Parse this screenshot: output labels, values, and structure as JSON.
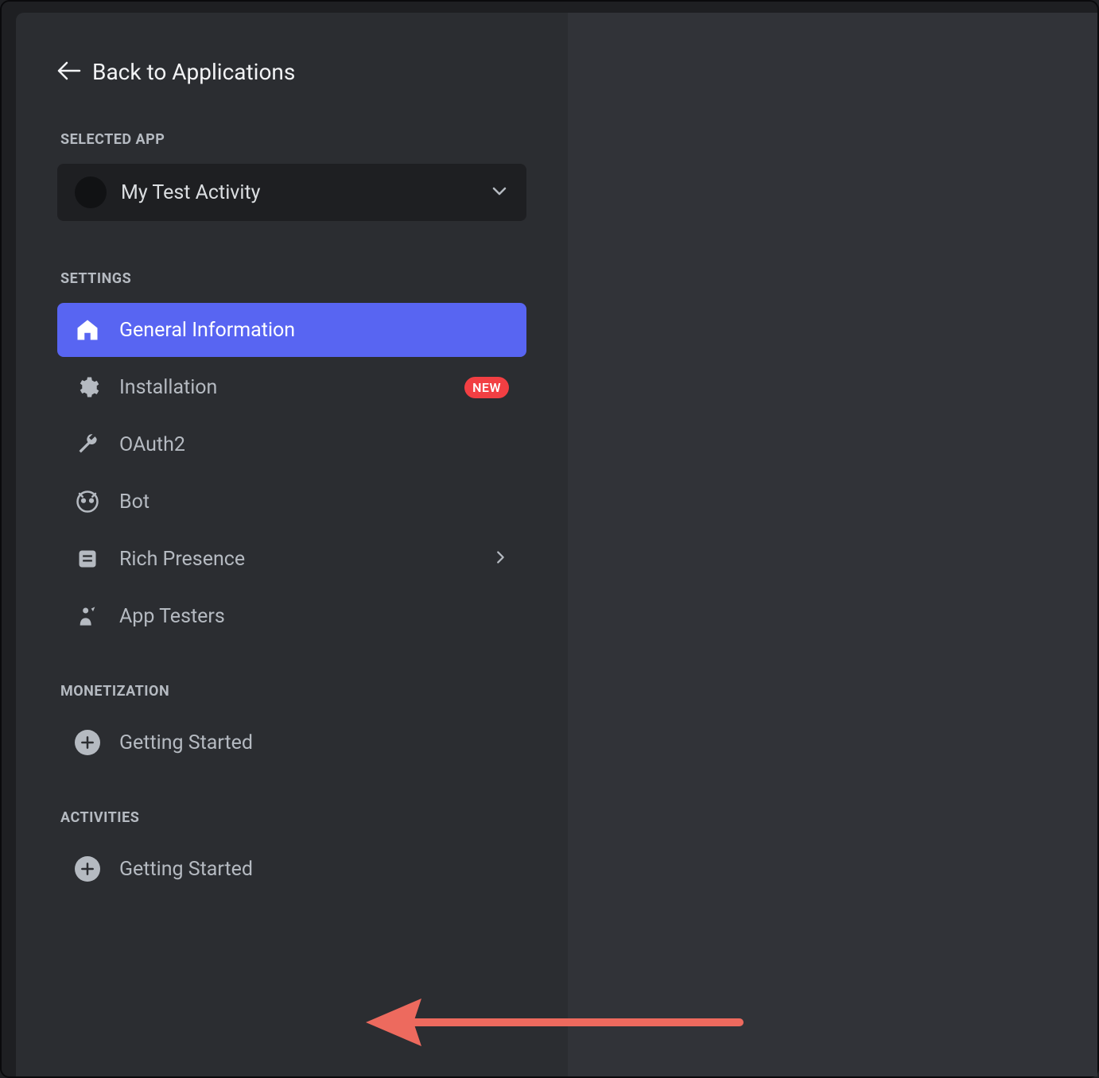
{
  "back_link": "Back to Applications",
  "selected_app_header": "SELECTED APP",
  "app_name": "My Test Activity",
  "settings_header": "SETTINGS",
  "settings_items": {
    "general": "General Information",
    "installation": "Installation",
    "installation_badge": "NEW",
    "oauth2": "OAuth2",
    "bot": "Bot",
    "rich_presence": "Rich Presence",
    "app_testers": "App Testers"
  },
  "monetization_header": "MONETIZATION",
  "monetization_items": {
    "getting_started": "Getting Started"
  },
  "activities_header": "ACTIVITIES",
  "activities_items": {
    "getting_started": "Getting Started"
  }
}
